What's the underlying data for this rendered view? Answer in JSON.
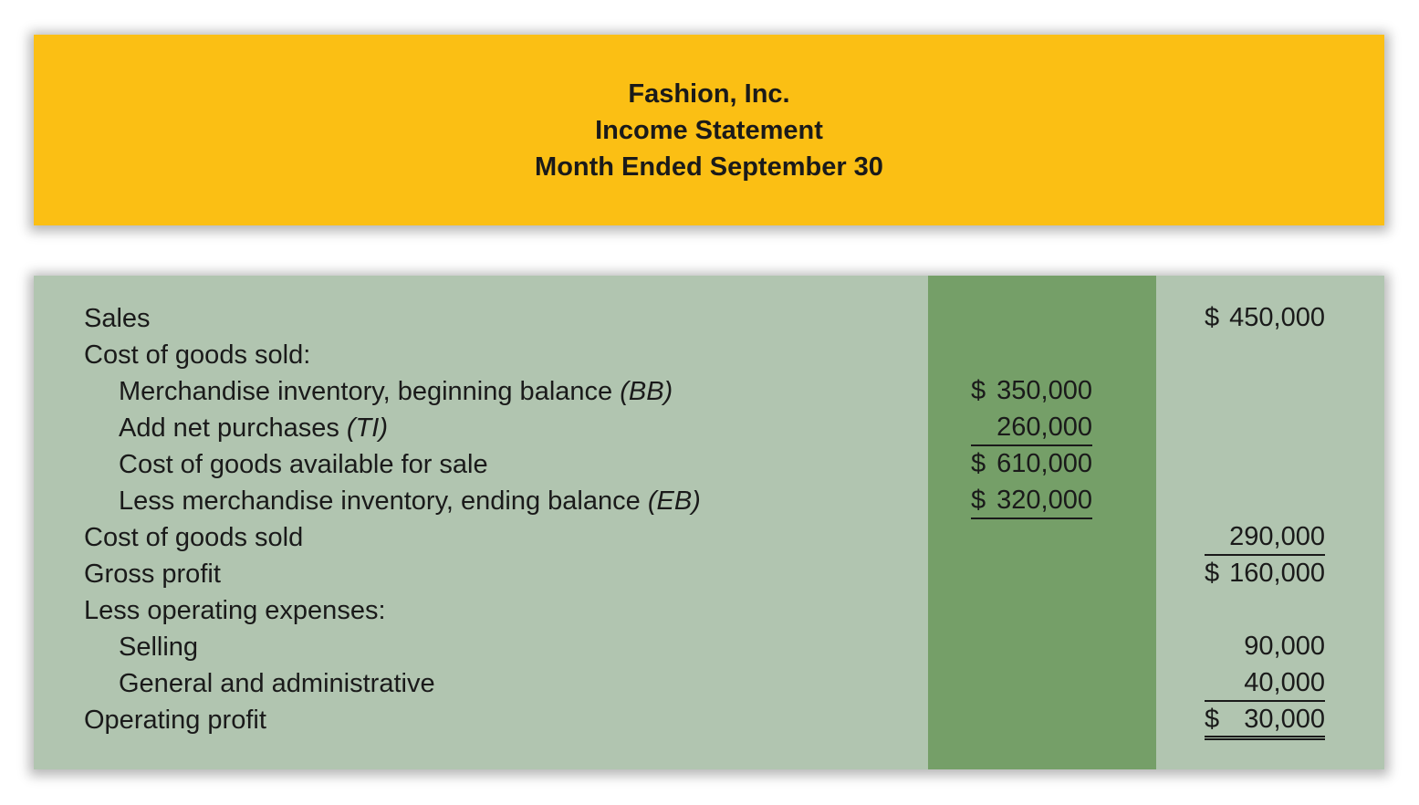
{
  "header": {
    "company": "Fashion, Inc.",
    "statement": "Income Statement",
    "period": "Month Ended September 30"
  },
  "rows": [
    {
      "label": "Sales",
      "abbr": "",
      "indent": 0,
      "mid": {
        "symbol": "",
        "value": ""
      },
      "right": {
        "symbol": "$",
        "value": "450,000"
      }
    },
    {
      "label": "Cost of goods sold:",
      "abbr": "",
      "indent": 0,
      "mid": {
        "symbol": "",
        "value": ""
      },
      "right": {
        "symbol": "",
        "value": ""
      }
    },
    {
      "label": "Merchandise inventory, beginning balance ",
      "abbr": "(BB)",
      "indent": 1,
      "mid": {
        "symbol": "$",
        "value": "350,000"
      },
      "right": {
        "symbol": "",
        "value": ""
      }
    },
    {
      "label": "Add net purchases ",
      "abbr": "(TI)",
      "indent": 1,
      "mid": {
        "symbol": "",
        "value": "260,000"
      },
      "right": {
        "symbol": "",
        "value": ""
      }
    },
    {
      "label": "Cost of goods available for sale",
      "abbr": "",
      "indent": 1,
      "mid": {
        "symbol": "$",
        "value": "610,000"
      },
      "right": {
        "symbol": "",
        "value": ""
      }
    },
    {
      "label": "Less merchandise inventory, ending balance ",
      "abbr": "(EB)",
      "indent": 1,
      "mid": {
        "symbol": "$",
        "value": "320,000"
      },
      "right": {
        "symbol": "",
        "value": ""
      }
    },
    {
      "label": "Cost of goods sold",
      "abbr": "",
      "indent": 0,
      "mid": {
        "symbol": "",
        "value": ""
      },
      "right": {
        "symbol": "",
        "value": "290,000"
      }
    },
    {
      "label": "Gross profit",
      "abbr": "",
      "indent": 0,
      "mid": {
        "symbol": "",
        "value": ""
      },
      "right": {
        "symbol": "$",
        "value": "160,000"
      }
    },
    {
      "label": "Less operating expenses:",
      "abbr": "",
      "indent": 0,
      "mid": {
        "symbol": "",
        "value": ""
      },
      "right": {
        "symbol": "",
        "value": ""
      }
    },
    {
      "label": "Selling",
      "abbr": "",
      "indent": 1,
      "mid": {
        "symbol": "",
        "value": ""
      },
      "right": {
        "symbol": "",
        "value": "90,000"
      }
    },
    {
      "label": "General and administrative",
      "abbr": "",
      "indent": 1,
      "mid": {
        "symbol": "",
        "value": ""
      },
      "right": {
        "symbol": "",
        "value": "40,000"
      }
    },
    {
      "label": "Operating profit",
      "abbr": "",
      "indent": 0,
      "mid": {
        "symbol": "",
        "value": ""
      },
      "right": {
        "symbol": "$",
        "value": "30,000"
      }
    }
  ]
}
